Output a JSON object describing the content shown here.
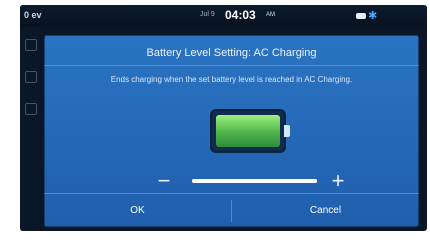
{
  "status": {
    "left": "0 ev",
    "center_small": "Jul 9",
    "time": "04:03",
    "ampm": "AM",
    "battery_icon": "battery-icon",
    "bt_icon": "bluetooth-icon"
  },
  "dialog": {
    "title": "Battery Level Setting: AC Charging",
    "subtitle": "Ends charging when the set battery level is reached in AC Charging.",
    "battery_label": "",
    "slider_level": 1.0,
    "ok_label": "OK",
    "cancel_label": "Cancel"
  },
  "colors": {
    "dialog_blue": "#2b74c2",
    "battery_green": "#4fb44b"
  },
  "icons": {
    "minus": "minus-icon",
    "plus": "plus-icon"
  }
}
